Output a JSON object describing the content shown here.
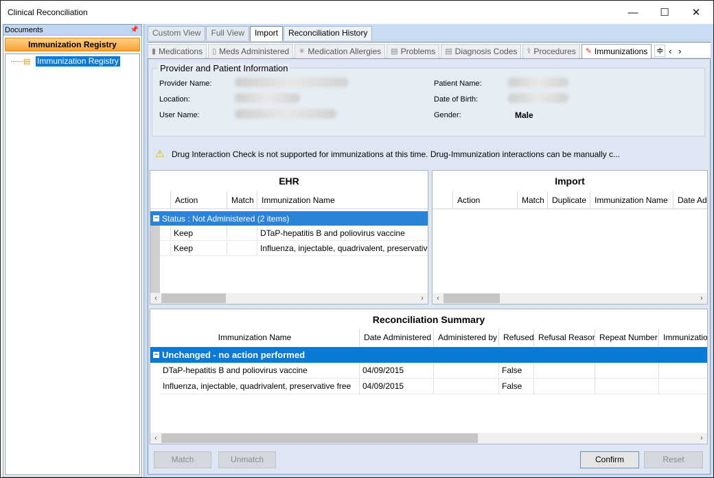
{
  "window": {
    "title": "Clinical Reconciliation"
  },
  "left": {
    "documents_label": "Documents",
    "registry_header": "Immunization Registry",
    "tree_item": "Immunization Registry"
  },
  "view_tabs": [
    "Custom View",
    "Full View",
    "Import",
    "Reconciliation History"
  ],
  "category_tabs": [
    {
      "label": "Medications",
      "icon": "capsule-icon"
    },
    {
      "label": "Meds Administered",
      "icon": "vial-icon"
    },
    {
      "label": "Medication Allergies",
      "icon": "allergy-icon"
    },
    {
      "label": "Problems",
      "icon": "clipboard-icon"
    },
    {
      "label": "Diagnosis Codes",
      "icon": "document-icon"
    },
    {
      "label": "Procedures",
      "icon": "caduceus-icon"
    },
    {
      "label": "Immunizations",
      "icon": "syringe-icon"
    }
  ],
  "provider_info": {
    "title": "Provider and Patient Information",
    "provider_name_label": "Provider Name:",
    "location_label": "Location:",
    "user_name_label": "User Name:",
    "patient_name_label": "Patient Name:",
    "dob_label": "Date of Birth:",
    "gender_label": "Gender:",
    "gender_value": "Male"
  },
  "warning_text": "Drug Interaction Check is not supported for immunizations at this time. Drug-Immunization interactions can be manually c...",
  "ehr": {
    "title": "EHR",
    "columns": [
      "Action",
      "Match",
      "Immunization Name"
    ],
    "group_label": "Status : Not Administered (2 items)",
    "rows": [
      {
        "action": "Keep",
        "match": "",
        "name": "DTaP-hepatitis B and poliovirus vaccine"
      },
      {
        "action": "Keep",
        "match": "",
        "name": "Influenza, injectable, quadrivalent, preservative"
      }
    ]
  },
  "import": {
    "title": "Import",
    "columns": [
      "Action",
      "Match",
      "Duplicate",
      "Immunization Name",
      "Date Adr"
    ]
  },
  "summary": {
    "title": "Reconciliation Summary",
    "columns": [
      "Immunization Name",
      "Date Administered",
      "Administered by",
      "Refused",
      "Refusal Reason",
      "Repeat Number",
      "Immunizatio"
    ],
    "group_label": "Unchanged - no action performed",
    "rows": [
      {
        "name": "DTaP-hepatitis B and poliovirus vaccine",
        "date": "04/09/2015",
        "by": "",
        "refused": "False",
        "reason": "",
        "repeat": "",
        "imm": ""
      },
      {
        "name": "Influenza, injectable, quadrivalent, preservative free",
        "date": "04/09/2015",
        "by": "",
        "refused": "False",
        "reason": "",
        "repeat": "",
        "imm": ""
      }
    ]
  },
  "buttons": {
    "match": "Match",
    "unmatch": "Unmatch",
    "confirm": "Confirm",
    "reset": "Reset"
  }
}
